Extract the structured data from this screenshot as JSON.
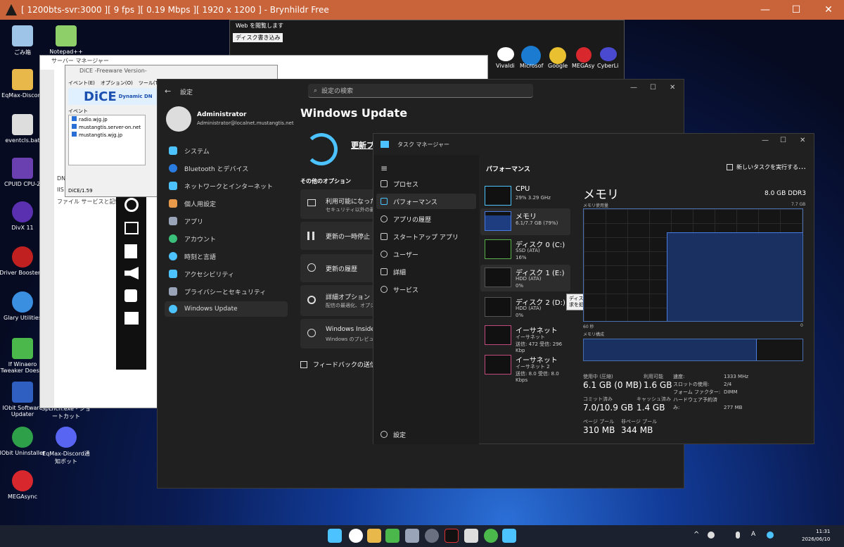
{
  "window": {
    "title": "[ 1200bts-svr:3000 ][ 9 fps ][ 0.19 Mbps ][ 1920 x 1200 ] - Brynhildr Free",
    "minimize": "—",
    "maximize": "☐",
    "close": "✕"
  },
  "desktop": {
    "icons": [
      {
        "label": "ごみ箱"
      },
      {
        "label": "Notepad++"
      },
      {
        "label": "EqMax-Discord"
      },
      {
        "label": "eventcls.bat"
      },
      {
        "label": "CPUID CPU-Z"
      },
      {
        "label": "DivX 11"
      },
      {
        "label": "Driver Booster 9"
      },
      {
        "label": "Glary Utilities"
      },
      {
        "label": "If Winaero Tweaker Does..."
      },
      {
        "label": "IObit Software Updater"
      },
      {
        "label": "SpLnch.exe - ショートカット"
      },
      {
        "label": "IObit Uninstaller"
      },
      {
        "label": "EqMax-Discord通知ボット"
      },
      {
        "label": "MEGAsync"
      }
    ]
  },
  "browser": {
    "title": "Web を閲覧します",
    "tab": "ディスク書き込み",
    "apps": [
      "Vivaldi",
      "Microsof",
      "Google",
      "MEGAsy",
      "CyberLi"
    ]
  },
  "server_manager": {
    "title": "サーバー マネージャー",
    "items": [
      "DNS",
      "IIS",
      "ファイル サービスと記憶域"
    ]
  },
  "dice": {
    "title": "DiCE -Freeware Version-",
    "menu": [
      "イベント(E)",
      "オプション(O)",
      "ツール(T)",
      "ヘル"
    ],
    "logo": "DiCE",
    "logo_sub": "Dynamic DN",
    "event_label": "イベント",
    "entries": [
      "radio.wjg.jp",
      "mustangtis.server-on.net",
      "mustangtis.wjg.jp"
    ],
    "status": "DiCE/1.59"
  },
  "settings": {
    "title": "設定",
    "search_placeholder": "設定の検索",
    "user_name": "Administrator",
    "user_email": "Administrator@localnet.mustangtis.net",
    "page_title": "Windows Update",
    "update_button": "更新プ",
    "nav": [
      "システム",
      "Bluetooth とデバイス",
      "ネットワークとインターネット",
      "個人用設定",
      "アプリ",
      "アカウント",
      "時刻と言語",
      "アクセシビリティ",
      "プライバシーとセキュリティ",
      "Windows Update"
    ],
    "more_options": "その他のオプション",
    "cards": [
      {
        "title": "利用可能になったら",
        "sub": "セキュリティ以外の最新"
      },
      {
        "title": "更新の一時停止",
        "sub": ""
      },
      {
        "title": "更新の履歴",
        "sub": ""
      },
      {
        "title": "詳細オプション",
        "sub": "配信の最適化、オプシ"
      },
      {
        "title": "Windows Insider",
        "sub": "Windows のプレビュー"
      }
    ],
    "feedback": "フィードバックの送信"
  },
  "taskmgr": {
    "title": "タスク マネージャー",
    "section": "パフォーマンス",
    "run_task": "新しいタスクを実行する",
    "more": "…",
    "settings": "設定",
    "nav": [
      "プロセス",
      "パフォーマンス",
      "アプリの履歴",
      "スタートアップ アプリ",
      "ユーザー",
      "詳細",
      "サービス"
    ],
    "perf_items": [
      {
        "name": "CPU",
        "sub": "29%  3.29 GHz",
        "sub2": ""
      },
      {
        "name": "メモリ",
        "sub": "6.1/7.7 GB (79%)",
        "sub2": ""
      },
      {
        "name": "ディスク 0 (C:)",
        "sub": "SSD (ATA)",
        "sub2": "16%"
      },
      {
        "name": "ディスク 1 (E:)",
        "sub": "HDD (ATA)",
        "sub2": "0%"
      },
      {
        "name": "ディスク 2 (D:)",
        "sub": "HDD (ATA)",
        "sub2": "0%"
      },
      {
        "name": "イーサネット",
        "sub": "イーサネット",
        "sub2": "送信: 472  受信: 296 Kbp"
      },
      {
        "name": "イーサネット",
        "sub": "イーサネット 2",
        "sub2": "送信: 8.0  受信: 8.0 Kbps"
      }
    ],
    "tooltip": "ディスクが読み取りまたは書き込み要求を処理している時間の割合",
    "memory": {
      "title": "メモリ",
      "capacity": "8.0 GB DDR3",
      "usage_label": "メモリ使用量",
      "max": "7.7 GB",
      "time_label": "60 秒",
      "zero": "0",
      "composition": "メモリ構成",
      "used_fraction": 0.79,
      "stats": [
        {
          "label": "使用中 (圧縮)",
          "value": "6.1 GB (0 MB)"
        },
        {
          "label": "利用可能",
          "value": "1.6 GB"
        },
        {
          "label": "コミット済み",
          "value": "7.0/10.9 GB"
        },
        {
          "label": "キャッシュ済み",
          "value": "1.4 GB"
        },
        {
          "label": "ページ プール",
          "value": "310 MB"
        },
        {
          "label": "非ページ プール",
          "value": "344 MB"
        }
      ],
      "details": [
        {
          "label": "速度:",
          "value": "1333 MHz"
        },
        {
          "label": "スロットの使用:",
          "value": "2/4"
        },
        {
          "label": "フォーム ファクター:",
          "value": "DIMM"
        },
        {
          "label": "ハードウェア予約済み:",
          "value": "277 MB"
        }
      ]
    }
  },
  "taskbar": {
    "clock_time": "11:31",
    "clock_date": "2026/06/10",
    "lang": "A"
  },
  "colors": {
    "title_bar": "#c8633a",
    "accent": "#4cc2ff",
    "memory_graph": "#2c6fd6"
  }
}
